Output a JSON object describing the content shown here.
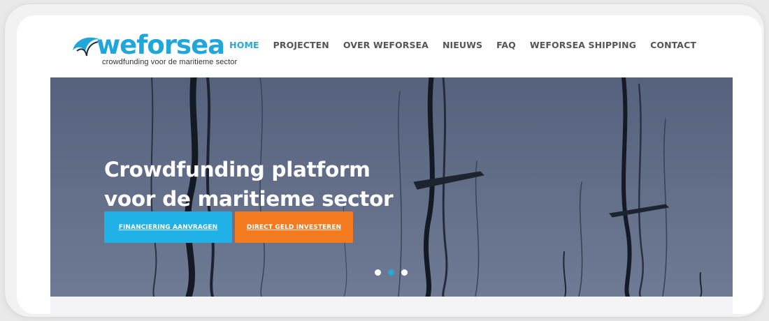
{
  "logo": {
    "wordmark": "weforsea",
    "tagline": "crowdfunding voor de maritieme sector"
  },
  "nav": {
    "items": [
      {
        "label": "HOME",
        "active": true
      },
      {
        "label": "PROJECTEN",
        "active": false
      },
      {
        "label": "OVER WEFORSEA",
        "active": false
      },
      {
        "label": "NIEUWS",
        "active": false
      },
      {
        "label": "FAQ",
        "active": false
      },
      {
        "label": "WEFORSEA SHIPPING",
        "active": false
      },
      {
        "label": "CONTACT",
        "active": false
      }
    ]
  },
  "hero": {
    "title_line1": "Crowdfunding platform",
    "title_line2": "voor de maritieme sector",
    "primary_button": "FINANCIERING AANVRAGEN",
    "secondary_button": "DIRECT GELD INVESTEREN",
    "slides_total": 3,
    "active_slide": 2
  },
  "colors": {
    "accent": "#2aa7d5",
    "primary_button": "#20b2e6",
    "secondary_button": "#f47a20",
    "hero_bg": "#66728c"
  }
}
